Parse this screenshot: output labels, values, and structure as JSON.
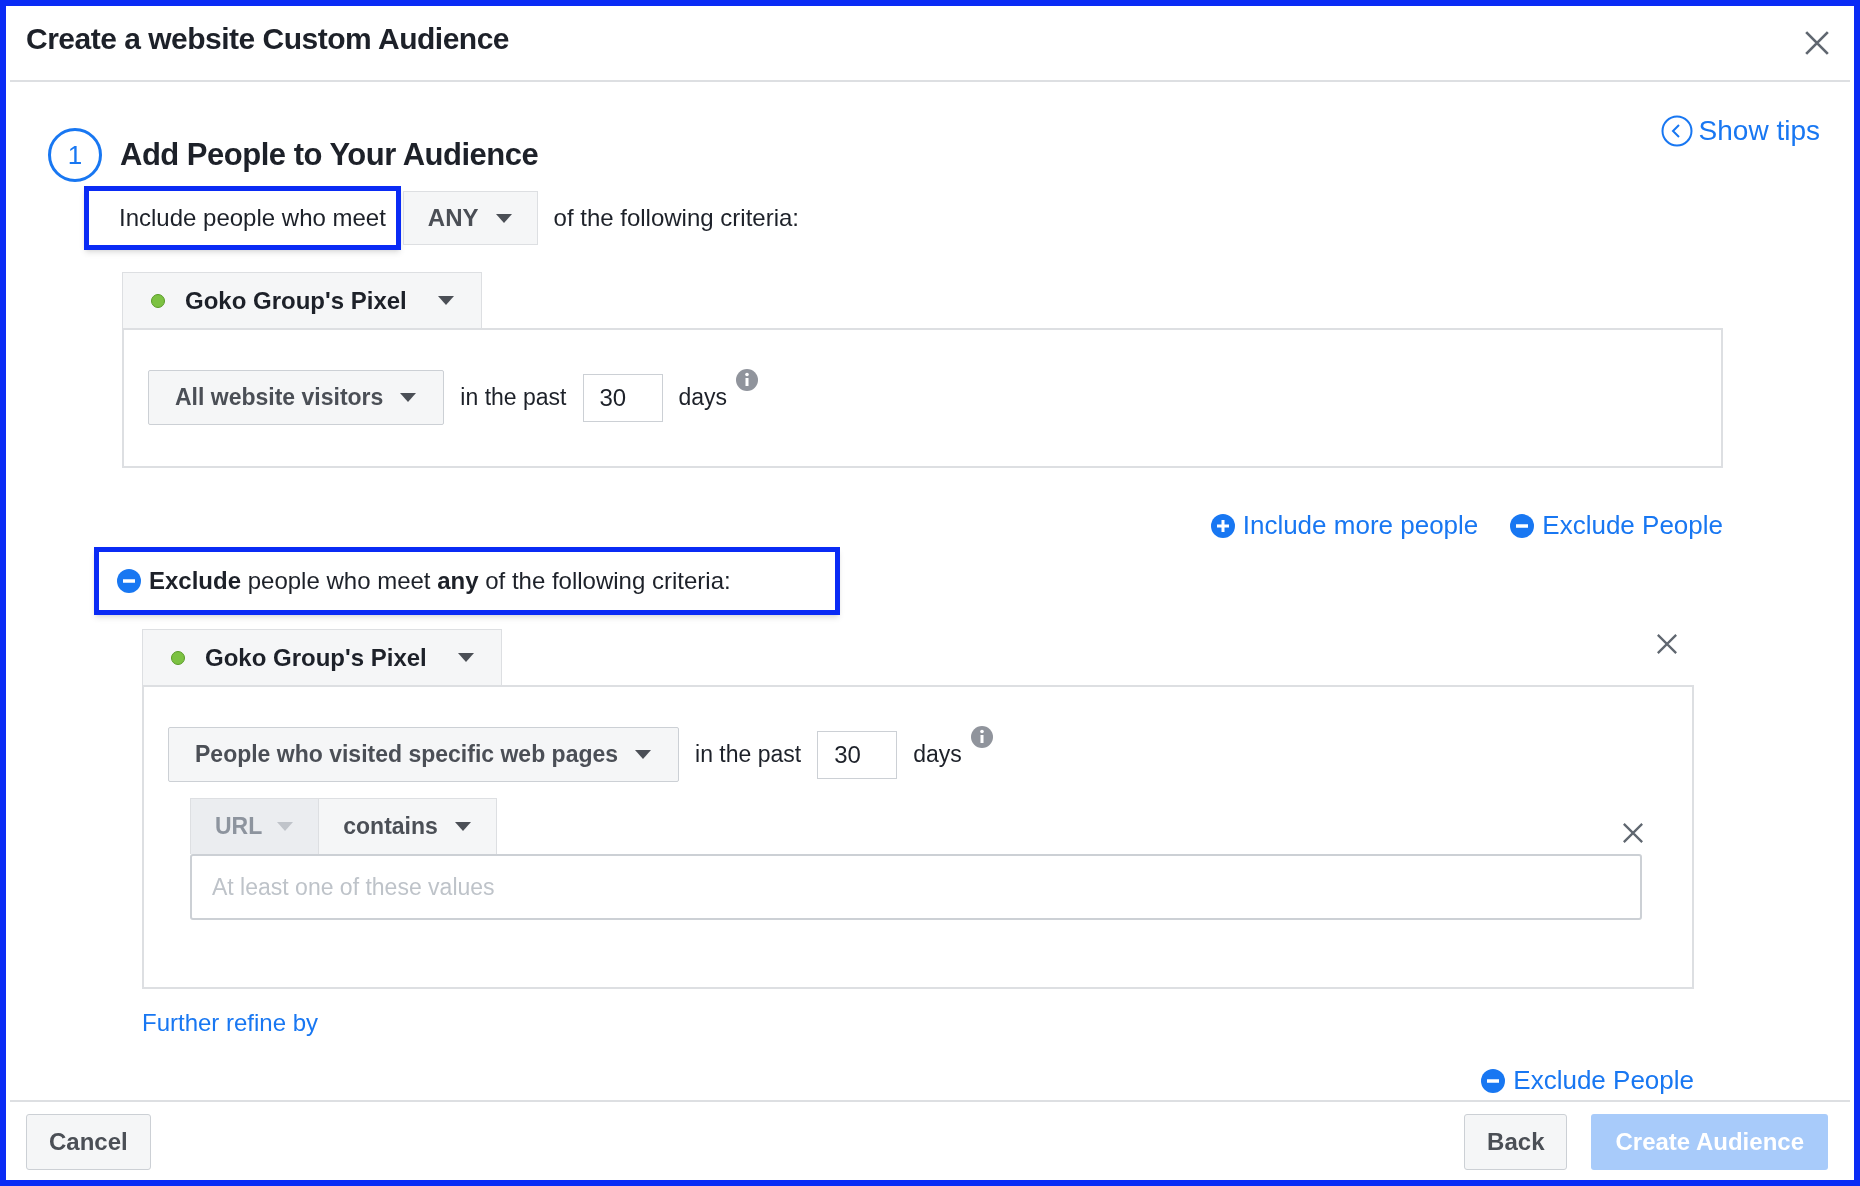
{
  "dialog": {
    "title": "Create a website Custom Audience"
  },
  "step": {
    "number": "1",
    "title": "Add People to Your Audience",
    "tips_link": "Show tips"
  },
  "include": {
    "label": "Include people who meet",
    "match": "ANY",
    "suffix": "of the following criteria:",
    "pixel": "Goko Group's Pixel",
    "event": "All website visitors",
    "past_label": "in the past",
    "days": "30",
    "days_label": "days"
  },
  "actions": [
    {
      "kind": "include",
      "label": "Include more people"
    },
    {
      "kind": "exclude",
      "label": "Exclude People"
    }
  ],
  "exclude": {
    "sentence": "**Exclude** people who meet **any** of the following criteria:",
    "pixel": "Goko Group's Pixel",
    "event": "People who visited specific web pages",
    "past_label": "in the past",
    "days": "30",
    "days_label": "days",
    "field": "URL",
    "field_disabled": true,
    "operator": "contains",
    "values_placeholder": "At least one of these values",
    "refine_link": "Further refine by",
    "exclude_link": "Exclude People"
  },
  "footer": {
    "cancel": "Cancel",
    "back": "Back",
    "create": "Create Audience",
    "create_disabled": true
  }
}
